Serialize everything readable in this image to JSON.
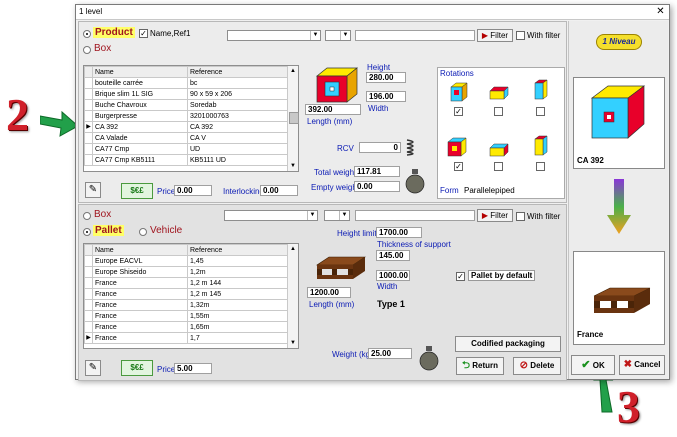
{
  "window": {
    "title": "1 level"
  },
  "product_section": {
    "product_label": "Product",
    "box_label": "Box",
    "name_ref_label": "Name,Ref1",
    "filter_label": "Filter",
    "with_filter_label": "With filter",
    "columns": [
      "Name",
      "Reference"
    ],
    "rows": [
      {
        "name": "bouteille carrée",
        "ref": "bc"
      },
      {
        "name": "Brique slim 1L SIG",
        "ref": "90 x 59 x 206"
      },
      {
        "name": "Buche Chavroux",
        "ref": "Soredab"
      },
      {
        "name": "Burgerpresse",
        "ref": "3201000763"
      },
      {
        "name": "CA 392",
        "ref": "CA 392"
      },
      {
        "name": "CA Valade",
        "ref": "CA V"
      },
      {
        "name": "CA77 Cmp",
        "ref": "UD"
      },
      {
        "name": "CA77 Cmp KB5111",
        "ref": "KB5111 UD"
      }
    ],
    "height_label": "Height",
    "height_value": "280.00",
    "width_value": "196.00",
    "width_label": "Width",
    "length_value": "392.00",
    "length_label": "Length (mm)",
    "rcv_label": "RCV",
    "rcv_value": "0",
    "total_weight_label": "Total weight",
    "total_weight_value": "117.81",
    "empty_weight_label": "Empty weight",
    "empty_weight_value": "0.00",
    "rotations_label": "Rotations",
    "form_label": "Form",
    "form_value": "Parallelepiped",
    "price_label": "Price",
    "price_value": "0.00",
    "interlocking_label": "Interlocking",
    "interlocking_value": "0.00",
    "money_label": "$€£"
  },
  "pallet_section": {
    "box_label": "Box",
    "pallet_label": "Pallet",
    "vehicle_label": "Vehicle",
    "filter_label": "Filter",
    "with_filter_label": "With filter",
    "columns": [
      "Name",
      "Reference"
    ],
    "rows": [
      {
        "name": "Europe EACVL",
        "ref": "1,45"
      },
      {
        "name": "Europe Shiseido",
        "ref": "1,2m"
      },
      {
        "name": "France",
        "ref": "1,2 m 144"
      },
      {
        "name": "France",
        "ref": "1,2 m 145"
      },
      {
        "name": "France",
        "ref": "1,32m"
      },
      {
        "name": "France",
        "ref": "1,55m"
      },
      {
        "name": "France",
        "ref": "1,65m"
      },
      {
        "name": "France",
        "ref": "1,7"
      }
    ],
    "height_limit_label": "Height limite",
    "height_limit_value": "1700.00",
    "thickness_label": "Thickness of support",
    "thickness_value": "145.00",
    "width_value": "1000.00",
    "width_label": "Width",
    "length_value": "1200.00",
    "length_label": "Length (mm)",
    "type_label": "Type 1",
    "pallet_default_label": "Pallet by default",
    "codified_label": "Codified packaging",
    "weight_label": "Weight (kg)",
    "weight_value": "25.00",
    "price_label": "Price",
    "price_value": "5.00",
    "return_label": "Return",
    "delete_label": "Delete",
    "money_label": "$€£"
  },
  "right_panel": {
    "niveau_label": "1 Niveau",
    "product_caption": "CA 392",
    "pallet_caption": "France",
    "ok_label": "OK",
    "cancel_label": "Cancel"
  },
  "annotations": {
    "step2": "2",
    "step3": "3"
  },
  "colors": {
    "highlight": "#ffff66",
    "accent_red": "#a0141e",
    "label_blue": "#0a1ab4",
    "arrow_green": "#22a04a"
  }
}
